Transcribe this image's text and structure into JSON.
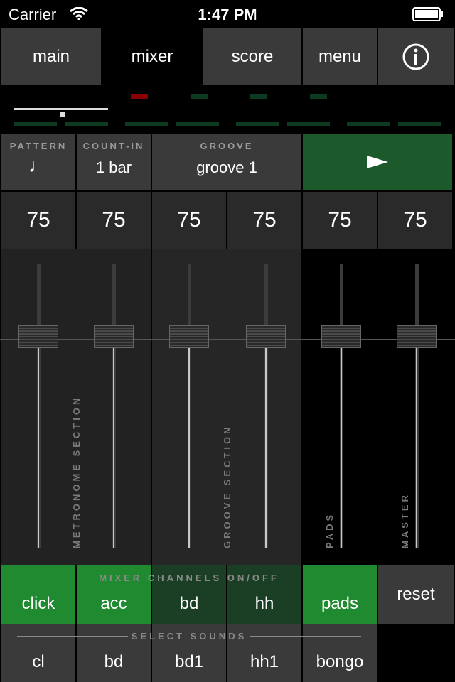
{
  "status_bar": {
    "carrier": "Carrier",
    "time": "1:47 PM"
  },
  "nav": {
    "main": "main",
    "mixer": "mixer",
    "score": "score",
    "menu": "menu",
    "info_icon": "info-icon"
  },
  "header": {
    "pattern_caption": "PATTERN",
    "pattern_value": "♩",
    "countin_caption": "COUNT-IN",
    "countin_value": "1 bar",
    "groove_caption": "GROOVE",
    "groove_value": "groove 1",
    "play_icon": "play-icon"
  },
  "levels": [
    "75",
    "75",
    "75",
    "75",
    "75",
    "75"
  ],
  "channel_levels": [
    0.75,
    0.75,
    0.75,
    0.75,
    0.75,
    0.75
  ],
  "section_labels": {
    "metronome": "METRONOME SECTION",
    "groove": "GROOVE SECTION",
    "pads": "PADS",
    "master": "MASTER"
  },
  "channels_caption": "MIXER CHANNELS ON/OFF",
  "channel_buttons": [
    {
      "label": "click",
      "on": true
    },
    {
      "label": "acc",
      "on": true
    },
    {
      "label": "bd",
      "on": false
    },
    {
      "label": "hh",
      "on": false
    },
    {
      "label": "pads",
      "on": true
    }
  ],
  "reset_label": "reset",
  "sounds_caption": "SELECT SOUNDS",
  "sound_buttons": [
    "cl",
    "bd",
    "bd1",
    "hh1",
    "bongo"
  ],
  "colors": {
    "accent_on": "#1f8a2f",
    "accent_off": "#1a3f25",
    "meter_red": "#8b0000",
    "meter_green": "#0f3a22",
    "play_bg": "#1c5a2c"
  }
}
